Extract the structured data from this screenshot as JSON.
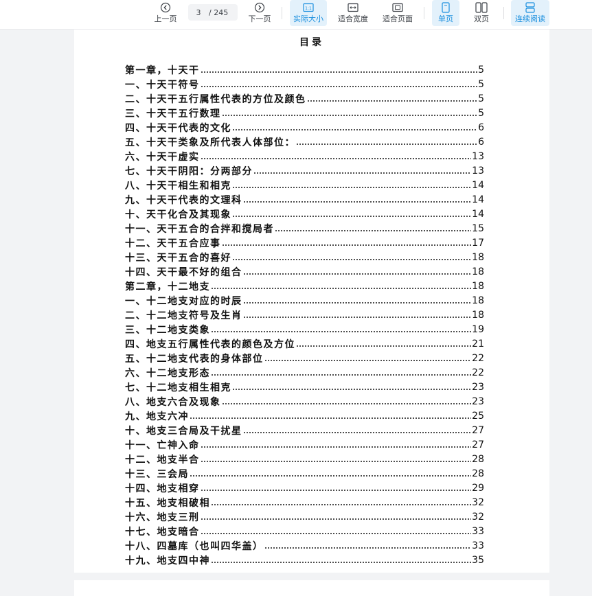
{
  "toolbar": {
    "prev_label": "上一页",
    "current_page": "3",
    "total_pages": "/ 245",
    "next_label": "下一页",
    "actual_size_label": "实际大小",
    "fit_width_label": "适合宽度",
    "fit_page_label": "适合页面",
    "single_page_label": "单页",
    "double_page_label": "双页",
    "continuous_label": "连续阅读",
    "accent_color": "#1a8fde"
  },
  "document": {
    "title": "目录",
    "entries": [
      {
        "title": "第一章，十天干",
        "page": "5"
      },
      {
        "title": "一、十天干符号",
        "page": "5"
      },
      {
        "title": "二、十天干五行属性代表的方位及颜色",
        "page": "5"
      },
      {
        "title": "三、十天干五行数理",
        "page": "5"
      },
      {
        "title": "四、十天干代表的文化",
        "page": "6"
      },
      {
        "title": "五、十天干类象及所代表人体部位：",
        "page": "6"
      },
      {
        "title": "六、十天干虚实",
        "page": "13"
      },
      {
        "title": "七、十天干阴阳：分两部分",
        "page": "13"
      },
      {
        "title": "八、十天干相生和相克",
        "page": "14"
      },
      {
        "title": "九、十天干代表的文理科",
        "page": "14"
      },
      {
        "title": "十、天干化合及其现象",
        "page": "14"
      },
      {
        "title": "十一、天干五合的合拌和搅局者",
        "page": "15"
      },
      {
        "title": "十二、天干五合应事",
        "page": "17"
      },
      {
        "title": "十三、天干五合的喜好",
        "page": "18"
      },
      {
        "title": "十四、天干最不好的组合",
        "page": "18"
      },
      {
        "title": "第二章，十二地支",
        "page": "18"
      },
      {
        "title": "一、十二地支对应的时辰",
        "page": "18"
      },
      {
        "title": "二、十二地支符号及生肖",
        "page": "18"
      },
      {
        "title": "三、十二地支类象",
        "page": "19"
      },
      {
        "title": "四、地支五行属性代表的颜色及方位",
        "page": "21"
      },
      {
        "title": "五、十二地支代表的身体部位",
        "page": "22"
      },
      {
        "title": "六、十二地支形态",
        "page": "22"
      },
      {
        "title": "七、十二地支相生相克",
        "page": "23"
      },
      {
        "title": "八、地支六合及现象",
        "page": "23"
      },
      {
        "title": "九、地支六冲",
        "page": "25"
      },
      {
        "title": "十、地支三合局及干扰星",
        "page": "27"
      },
      {
        "title": "十一、亡神入命",
        "page": "27"
      },
      {
        "title": "十二、地支半合",
        "page": "28"
      },
      {
        "title": "十三、三会局",
        "page": "28"
      },
      {
        "title": "十四、地支相穿",
        "page": "29"
      },
      {
        "title": "十五、地支相破相",
        "page": "32"
      },
      {
        "title": "十六、地支三刑",
        "page": "32"
      },
      {
        "title": "十七、地支暗合",
        "page": "33"
      },
      {
        "title": "十八、四墓库（也叫四华盖）",
        "page": "33"
      },
      {
        "title": "十九、地支四中神",
        "page": "35"
      }
    ]
  }
}
